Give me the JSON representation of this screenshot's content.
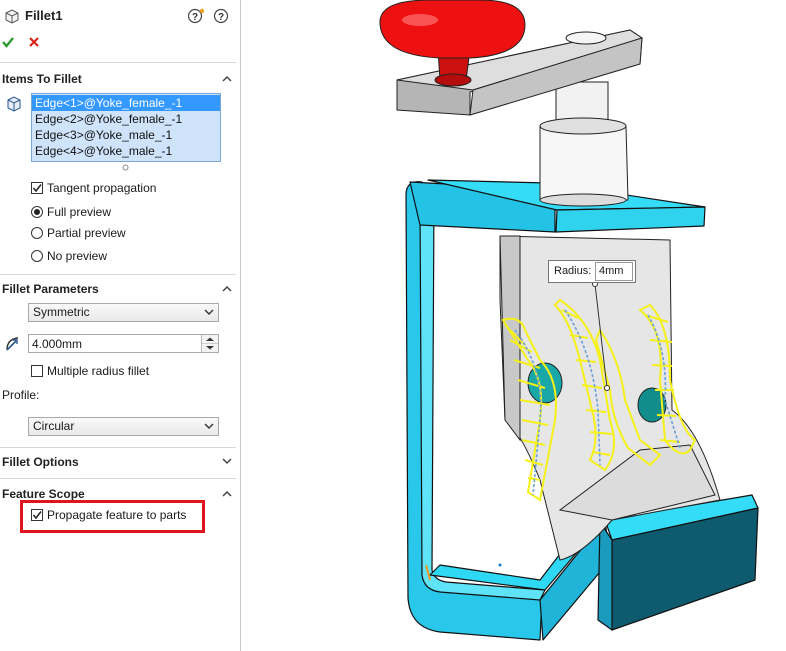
{
  "panel": {
    "title": "Fillet1",
    "items_section": {
      "title": "Items To Fillet",
      "edges": [
        "Edge<1>@Yoke_female_-1",
        "Edge<2>@Yoke_female_-1",
        "Edge<3>@Yoke_male_-1",
        "Edge<4>@Yoke_male_-1"
      ],
      "tangent_label": "Tangent propagation",
      "tangent_checked": true,
      "preview_options": [
        "Full preview",
        "Partial preview",
        "No preview"
      ],
      "preview_selected": "Full preview"
    },
    "params_section": {
      "title": "Fillet Parameters",
      "type_value": "Symmetric",
      "radius_value": "4.000mm",
      "multiple_radius_label": "Multiple radius fillet",
      "multiple_radius_checked": false,
      "profile_label": "Profile:",
      "profile_value": "Circular"
    },
    "options_section": {
      "title": "Fillet Options"
    },
    "scope_section": {
      "title": "Feature Scope",
      "propagate_label": "Propagate feature to parts",
      "propagate_checked": true
    }
  },
  "viewport": {
    "callout_label": "Radius:",
    "callout_value": "4mm"
  },
  "colors": {
    "highlight_box": "#e0141e",
    "selection_blue": "#3399ff",
    "list_bg": "#cfe4fa",
    "accept_green": "#2e9a2e",
    "cancel_red": "#d9221c",
    "model_cyan": "#2fd9f5",
    "model_red": "#ee1111",
    "preview_yellow": "#f5f018"
  }
}
